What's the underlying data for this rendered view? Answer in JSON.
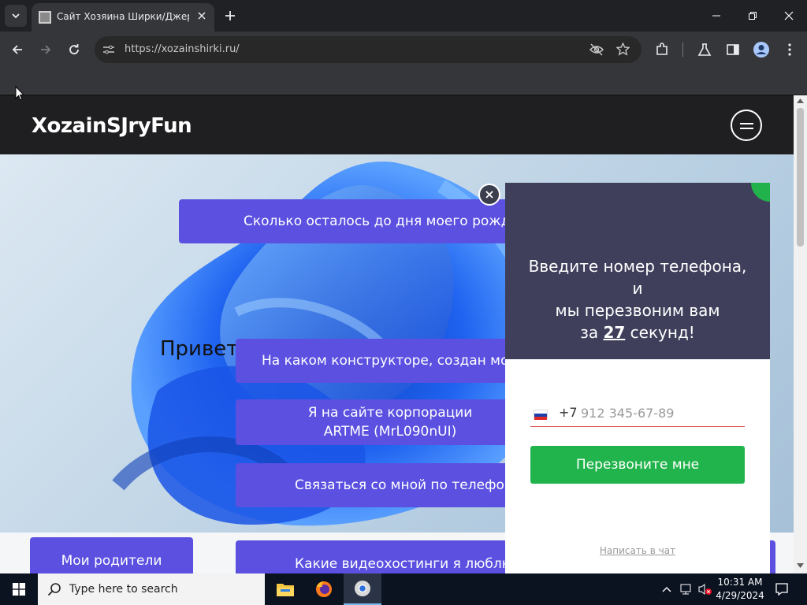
{
  "browser": {
    "tab_title": "Сайт Хозяина Ширки/Джерри",
    "url": "https://xozainshirki.ru/"
  },
  "site": {
    "logo": "XozainSJryFun",
    "hero_heading": "Привет! Ты зашел на сайт Хозяина Ширки!",
    "buttons": {
      "birthday": "Сколько осталось до дня моего рождения?",
      "constructor": "На каком конструкторе, создан мой сайт?",
      "artme": "Я на сайте корпорации ARTME (MrL090nUI)",
      "phone": "Связаться со мной по телефону",
      "parents": "Мои родители",
      "video": "Какие видеохостинги я люблю?"
    }
  },
  "popup": {
    "message_line1": "Введите номер телефона, и",
    "message_line2": "мы перезвоним вам",
    "message_pre": "за",
    "seconds": "27",
    "message_post": "секунд!",
    "phone_prefix": "+7",
    "phone_placeholder": "912 345-67-89",
    "callback_button": "Перезвоните мне",
    "chat_link": "Написать в чат"
  },
  "taskbar": {
    "search_placeholder": "Type here to search",
    "time": "10:31 AM",
    "date": "4/29/2024"
  },
  "colors": {
    "pill": "#5b50e0",
    "popup_dark": "#3f3f5c",
    "callback_green": "#22b44c"
  }
}
